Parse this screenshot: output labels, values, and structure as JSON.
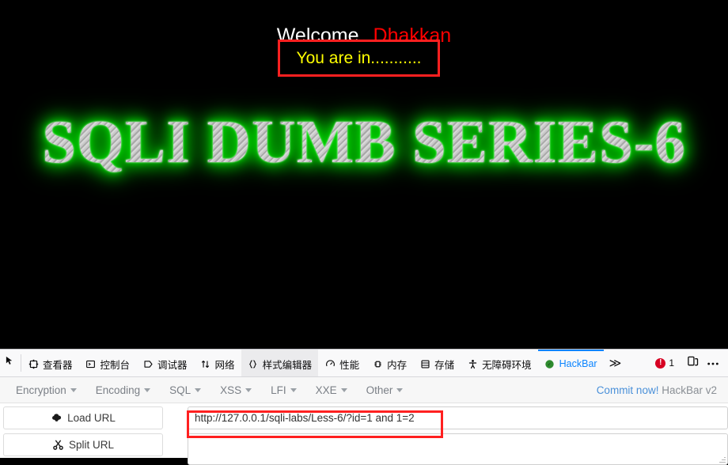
{
  "page": {
    "welcome_prefix": "Welcome",
    "welcome_name": "Dhakkan",
    "result_text": "You are in...........",
    "big_title": "SQLI DUMB SERIES-6",
    "background_color": "#000000",
    "welcome_prefix_color": "#ffffff",
    "welcome_name_color": "#ff0000",
    "result_text_color": "#ffff00",
    "result_box_border_color": "#ff2020",
    "title_glow_color": "#00e000"
  },
  "devtools": {
    "picker_icon": "element-picker-icon",
    "tabs": [
      {
        "label": "查看器",
        "icon": "inspector-icon",
        "name": "tab-inspector",
        "state": "normal"
      },
      {
        "label": "控制台",
        "icon": "console-icon",
        "name": "tab-console",
        "state": "normal"
      },
      {
        "label": "调试器",
        "icon": "debugger-icon",
        "name": "tab-debugger",
        "state": "normal"
      },
      {
        "label": "网络",
        "icon": "network-icon",
        "name": "tab-network",
        "state": "normal"
      },
      {
        "label": "样式编辑器",
        "icon": "style-editor-icon",
        "name": "tab-style-editor",
        "state": "hovered"
      },
      {
        "label": "性能",
        "icon": "performance-icon",
        "name": "tab-performance",
        "state": "normal"
      },
      {
        "label": "内存",
        "icon": "memory-icon",
        "name": "tab-memory",
        "state": "normal"
      },
      {
        "label": "存储",
        "icon": "storage-icon",
        "name": "tab-storage",
        "state": "normal"
      },
      {
        "label": "无障碍环境",
        "icon": "accessibility-icon",
        "name": "tab-accessibility",
        "state": "normal"
      },
      {
        "label": "HackBar",
        "icon": "hackbar-icon",
        "name": "tab-hackbar",
        "state": "active"
      }
    ],
    "overflow_chevron": "≫",
    "error_count": "1",
    "responsive_mode_icon": "responsive-design-mode-icon",
    "meatball_menu_icon": "more-options-icon",
    "active_tab_color": "#0a84ff",
    "error_badge_color": "#d70022"
  },
  "hackbar": {
    "menus": [
      {
        "label": "Encryption",
        "name": "hb-menu-encryption"
      },
      {
        "label": "Encoding",
        "name": "hb-menu-encoding"
      },
      {
        "label": "SQL",
        "name": "hb-menu-sql"
      },
      {
        "label": "XSS",
        "name": "hb-menu-xss"
      },
      {
        "label": "LFI",
        "name": "hb-menu-lfi"
      },
      {
        "label": "XXE",
        "name": "hb-menu-xxe"
      },
      {
        "label": "Other",
        "name": "hb-menu-other"
      }
    ],
    "commit_label": "Commit now!",
    "version_label": "HackBar v2",
    "commit_color": "#4a90d9",
    "load_url_label": "Load URL",
    "split_url_label": "Split URL",
    "load_url_icon": "cloud-download-icon",
    "split_url_icon": "scissors-icon",
    "url_value": "http://127.0.0.1/sqli-labs/Less-6/?id=1 and 1=2",
    "url_placeholder": "",
    "post_data_value": "",
    "post_data_placeholder": "",
    "url_highlight_color": "#ff2020"
  }
}
